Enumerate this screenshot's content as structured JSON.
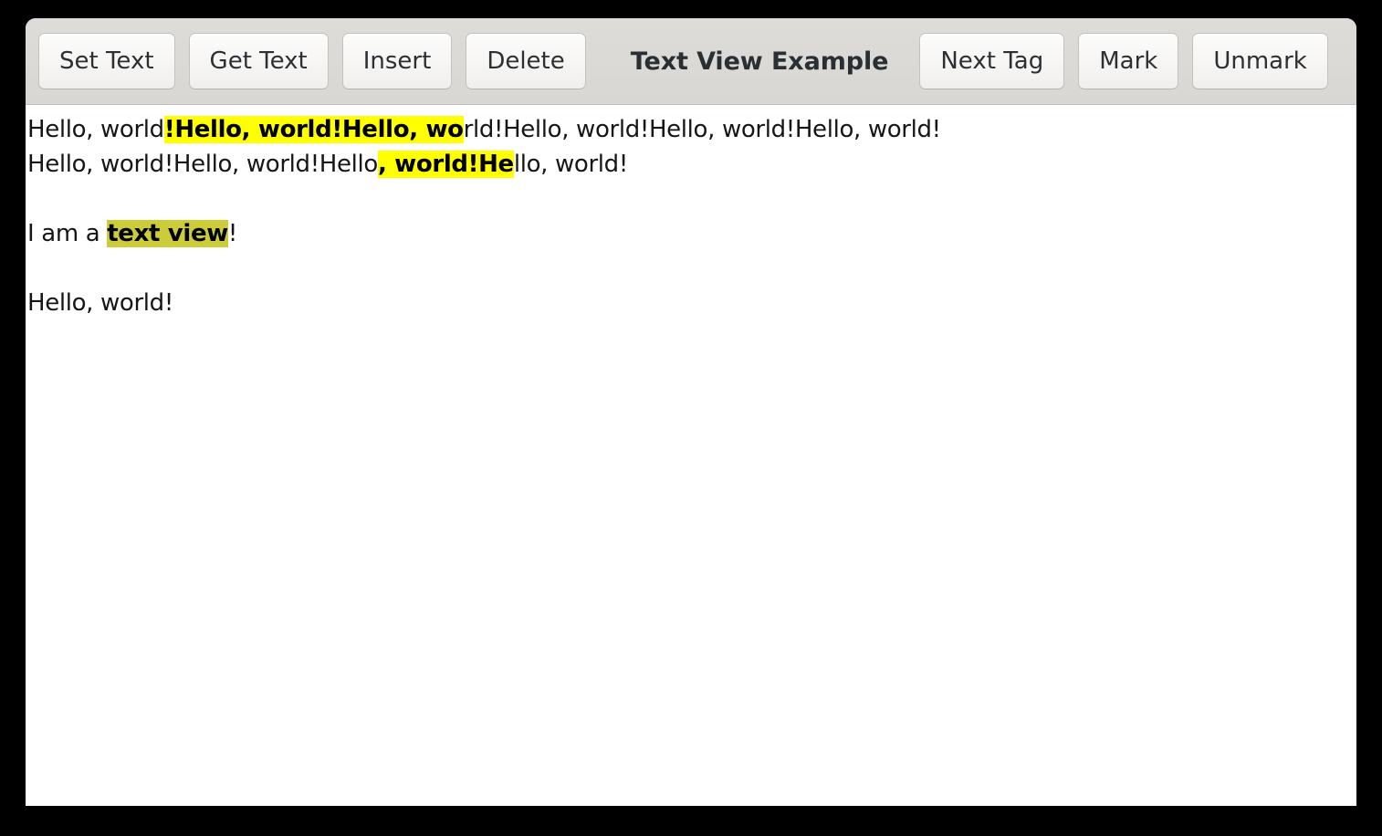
{
  "window": {
    "title": "Text View Example",
    "close_icon": "close-icon"
  },
  "toolbar": {
    "left_buttons": [
      {
        "name": "set-text-button",
        "label": "Set Text"
      },
      {
        "name": "get-text-button",
        "label": "Get Text"
      },
      {
        "name": "insert-button",
        "label": "Insert"
      },
      {
        "name": "delete-button",
        "label": "Delete"
      }
    ],
    "right_buttons": [
      {
        "name": "next-tag-button",
        "label": "Next Tag"
      },
      {
        "name": "mark-button",
        "label": "Mark"
      },
      {
        "name": "unmark-button",
        "label": "Unmark"
      }
    ]
  },
  "colors": {
    "headerbar_bg": "#dedcd8",
    "button_bg": "#f6f5f4",
    "title_fg": "#2a2f33",
    "text_fg": "#161616",
    "highlight_bright": "#ffff00",
    "highlight_olive": "#cccc3a",
    "window_bg": "#ffffff",
    "desktop_bg": "#000000"
  },
  "text_view": {
    "lines": [
      {
        "name": "text-line-1",
        "segments": [
          {
            "text": "Hello, world",
            "style": "plain"
          },
          {
            "text": "!Hello, world!Hello, wo",
            "style": "bright"
          },
          {
            "text": "rld!Hello, world!Hello, world!Hello, world!",
            "style": "plain"
          }
        ]
      },
      {
        "name": "text-line-2",
        "segments": [
          {
            "text": "Hello, world!Hello, world!Hello",
            "style": "plain"
          },
          {
            "text": ", world!He",
            "style": "bright"
          },
          {
            "text": "llo, world!",
            "style": "plain"
          }
        ]
      },
      {
        "name": "text-line-3-blank",
        "segments": [
          {
            "text": "",
            "style": "plain"
          }
        ]
      },
      {
        "name": "text-line-4",
        "segments": [
          {
            "text": "I am a ",
            "style": "plain"
          },
          {
            "text": "text view",
            "style": "olive"
          },
          {
            "text": "!",
            "style": "plain"
          }
        ]
      },
      {
        "name": "text-line-5-blank",
        "segments": [
          {
            "text": "",
            "style": "plain"
          }
        ]
      },
      {
        "name": "text-line-6",
        "segments": [
          {
            "text": "Hello, world!",
            "style": "plain"
          }
        ]
      }
    ]
  }
}
